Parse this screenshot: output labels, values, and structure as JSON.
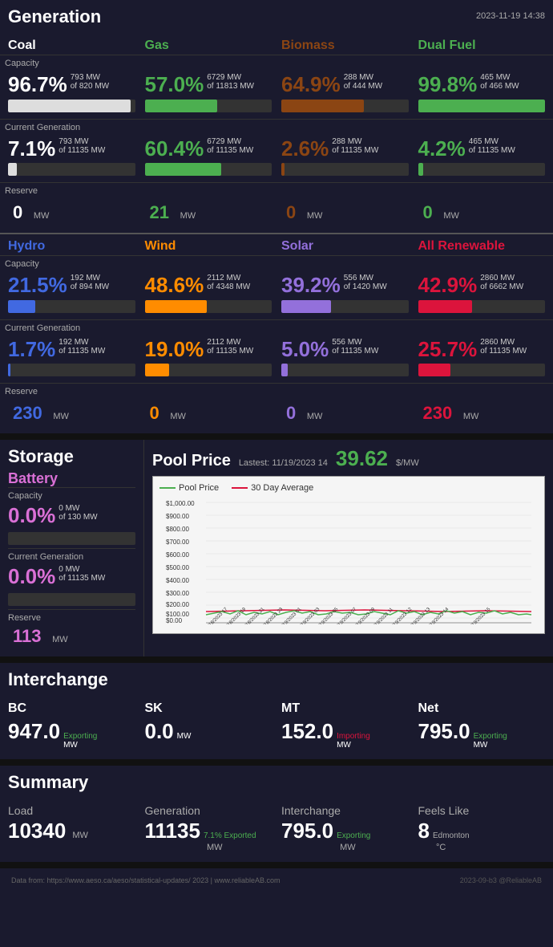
{
  "app": {
    "title": "Generation",
    "timestamp": "2023-11-19 14:38"
  },
  "generation": {
    "sections": {
      "capacity_label": "Capacity",
      "current_label": "Current Generation",
      "reserve_label": "Reserve"
    },
    "coal": {
      "label": "Coal",
      "capacity_pct": "96.7%",
      "capacity_mw": "793 MW",
      "capacity_total": "of 820 MW",
      "capacity_bar": 96.7,
      "current_pct": "7.1%",
      "current_mw": "793 MW",
      "current_total": "of 11135 MW",
      "current_bar": 7.1,
      "reserve": "0",
      "reserve_unit": "MW"
    },
    "gas": {
      "label": "Gas",
      "capacity_pct": "57.0%",
      "capacity_mw": "6729 MW",
      "capacity_total": "of 11813 MW",
      "capacity_bar": 57.0,
      "current_pct": "60.4%",
      "current_mw": "6729 MW",
      "current_total": "of 11135 MW",
      "current_bar": 60.4,
      "reserve": "21",
      "reserve_unit": "MW"
    },
    "biomass": {
      "label": "Biomass",
      "capacity_pct": "64.9%",
      "capacity_mw": "288 MW",
      "capacity_total": "of 444 MW",
      "capacity_bar": 64.9,
      "current_pct": "2.6%",
      "current_mw": "288 MW",
      "current_total": "of 11135 MW",
      "current_bar": 2.6,
      "reserve": "0",
      "reserve_unit": "MW"
    },
    "dualfuel": {
      "label": "Dual Fuel",
      "capacity_pct": "99.8%",
      "capacity_mw": "465 MW",
      "capacity_total": "of 466 MW",
      "capacity_bar": 99.8,
      "current_pct": "4.2%",
      "current_mw": "465 MW",
      "current_total": "of 11135 MW",
      "current_bar": 4.2,
      "reserve": "0",
      "reserve_unit": "MW"
    },
    "hydro": {
      "label": "Hydro",
      "capacity_pct": "21.5%",
      "capacity_mw": "192 MW",
      "capacity_total": "of 894 MW",
      "capacity_bar": 21.5,
      "current_pct": "1.7%",
      "current_mw": "192 MW",
      "current_total": "of 11135 MW",
      "current_bar": 1.7,
      "reserve": "230",
      "reserve_unit": "MW"
    },
    "wind": {
      "label": "Wind",
      "capacity_pct": "48.6%",
      "capacity_mw": "2112 MW",
      "capacity_total": "of 4348 MW",
      "capacity_bar": 48.6,
      "current_pct": "19.0%",
      "current_mw": "2112 MW",
      "current_total": "of 11135 MW",
      "current_bar": 19.0,
      "reserve": "0",
      "reserve_unit": "MW"
    },
    "solar": {
      "label": "Solar",
      "capacity_pct": "39.2%",
      "capacity_mw": "556 MW",
      "capacity_total": "of 1420 MW",
      "capacity_bar": 39.2,
      "current_pct": "5.0%",
      "current_mw": "556 MW",
      "current_total": "of 11135 MW",
      "current_bar": 5.0,
      "reserve": "0",
      "reserve_unit": "MW"
    },
    "allrenewable": {
      "label": "All Renewable",
      "capacity_pct": "42.9%",
      "capacity_mw": "2860 MW",
      "capacity_total": "of 6662 MW",
      "capacity_bar": 42.9,
      "current_pct": "25.7%",
      "current_mw": "2860 MW",
      "current_total": "of 11135 MW",
      "current_bar": 25.7,
      "reserve": "230",
      "reserve_unit": "MW"
    }
  },
  "storage": {
    "title": "Storage",
    "battery": {
      "label": "Battery",
      "capacity_label": "Capacity",
      "capacity_pct": "0.0%",
      "capacity_mw": "0 MW",
      "capacity_total": "of 130 MW",
      "capacity_bar": 0,
      "current_label": "Current Generation",
      "current_pct": "0.0%",
      "current_mw": "0 MW",
      "current_total": "of 11135 MW",
      "current_bar": 0,
      "reserve_label": "Reserve",
      "reserve": "113",
      "reserve_unit": "MW"
    }
  },
  "poolprice": {
    "title": "Pool Price",
    "latest_label": "Lastest: 11/19/2023 14",
    "value": "39.62",
    "unit": "$/MW",
    "legend": {
      "pool_price": "Pool Price",
      "avg_30day": "30 Day Average"
    }
  },
  "interchange": {
    "title": "Interchange",
    "bc": {
      "label": "BC",
      "value": "947.0",
      "unit": "MW",
      "status": "Exporting"
    },
    "sk": {
      "label": "SK",
      "value": "0.0",
      "unit": "MW",
      "status": ""
    },
    "mt": {
      "label": "MT",
      "value": "152.0",
      "unit": "MW",
      "status": "Importing"
    },
    "net": {
      "label": "Net",
      "value": "795.0",
      "unit": "MW",
      "status": "Exporting"
    }
  },
  "summary": {
    "title": "Summary",
    "load": {
      "label": "Load",
      "value": "10340",
      "unit": "MW"
    },
    "generation": {
      "label": "Generation",
      "value": "11135",
      "unit": "MW",
      "sub": "7.1% Exported"
    },
    "interchange": {
      "label": "Interchange",
      "value": "795.0",
      "unit": "MW",
      "status": "Exporting"
    },
    "feelslike": {
      "label": "Feels Like",
      "value": "8",
      "unit": "°C",
      "location": "Edmonton"
    }
  },
  "footer": {
    "note": "Data from: https://www.aeso.ca/aeso/statistical-updates/ 2023 | www.reliableAB.com",
    "watermark": "2023-09-b3  @ReliableAB"
  }
}
